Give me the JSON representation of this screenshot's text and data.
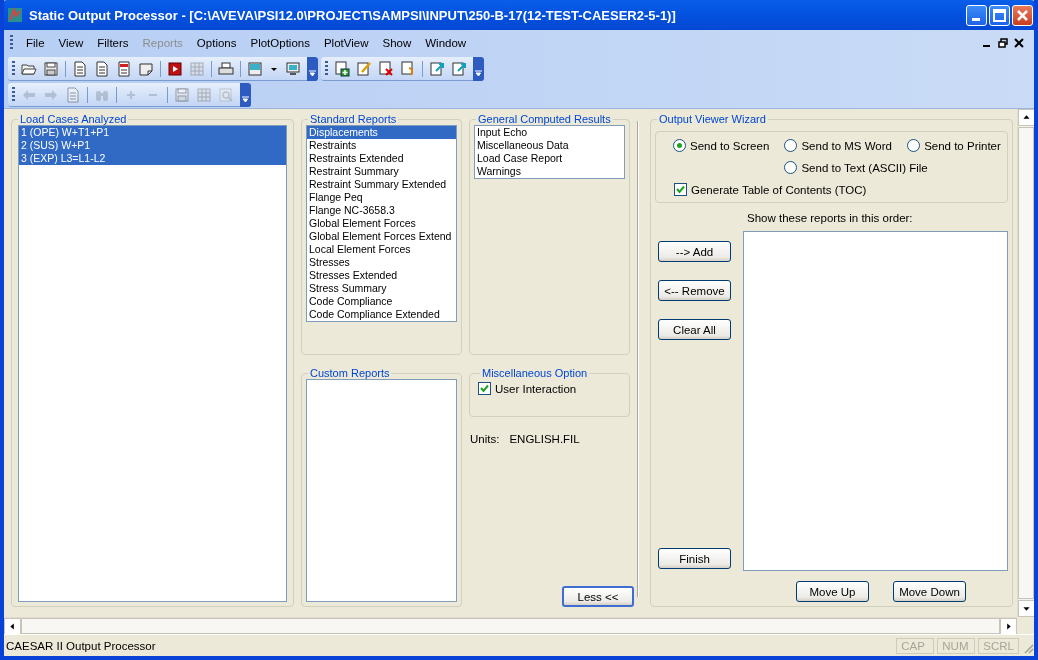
{
  "window": {
    "title": "Static Output Processor - [C:\\AVEVA\\PSI12.0\\PROJECT\\SAMPSI\\INPUT\\250-B-17(12-TEST-CAESER2-5-1)]"
  },
  "menu": [
    {
      "label": "File",
      "disabled": false
    },
    {
      "label": "View",
      "disabled": false
    },
    {
      "label": "Filters",
      "disabled": false
    },
    {
      "label": "Reports",
      "disabled": true
    },
    {
      "label": "Options",
      "disabled": false
    },
    {
      "label": "PlotOptions",
      "disabled": false
    },
    {
      "label": "PlotView",
      "disabled": false
    },
    {
      "label": "Show",
      "disabled": false
    },
    {
      "label": "Window",
      "disabled": false
    }
  ],
  "toolbars": [
    [
      [
        {
          "kind": "open",
          "disabled": false
        },
        {
          "kind": "save",
          "disabled": false
        }
      ],
      [
        {
          "kind": "page",
          "disabled": false
        },
        {
          "kind": "page",
          "disabled": false
        },
        {
          "kind": "redpage",
          "disabled": false
        },
        {
          "kind": "fold",
          "disabled": false
        }
      ],
      [
        {
          "kind": "play",
          "disabled": false
        },
        {
          "kind": "grid",
          "disabled": true
        }
      ],
      [
        {
          "kind": "print",
          "disabled": false
        }
      ],
      [
        {
          "kind": "word",
          "disabled": false
        },
        {
          "kind": "caret",
          "disabled": false
        },
        {
          "kind": "monitor",
          "disabled": false
        }
      ]
    ],
    [
      [
        {
          "kind": "adddoc",
          "disabled": false
        },
        {
          "kind": "editdoc",
          "disabled": false
        },
        {
          "kind": "deldoc",
          "disabled": false
        },
        {
          "kind": "arrowdoc",
          "disabled": false
        }
      ],
      [
        {
          "kind": "exportdoc",
          "disabled": false
        },
        {
          "kind": "exportdoc",
          "disabled": false
        }
      ]
    ],
    [
      [
        {
          "kind": "left",
          "disabled": true
        },
        {
          "kind": "right",
          "disabled": true
        },
        {
          "kind": "page",
          "disabled": true
        }
      ],
      [
        {
          "kind": "binoculars",
          "disabled": true
        }
      ],
      [
        {
          "kind": "plus",
          "disabled": true
        },
        {
          "kind": "minus",
          "disabled": true
        }
      ],
      [
        {
          "kind": "save",
          "disabled": true
        },
        {
          "kind": "grid",
          "disabled": true
        },
        {
          "kind": "zoom",
          "disabled": true
        }
      ]
    ]
  ],
  "load_cases": {
    "title": "Load Cases Analyzed",
    "items": [
      {
        "label": "1 (OPE) W+T1+P1",
        "selected": true
      },
      {
        "label": "2 (SUS) W+P1",
        "selected": true
      },
      {
        "label": "3 (EXP) L3=L1-L2",
        "selected": true
      }
    ]
  },
  "standard_reports": {
    "title": "Standard Reports",
    "items": [
      {
        "label": "Displacements",
        "selected": true
      },
      {
        "label": "Restraints",
        "selected": false
      },
      {
        "label": "Restraints Extended",
        "selected": false
      },
      {
        "label": "Restraint Summary",
        "selected": false
      },
      {
        "label": "Restraint Summary Extended",
        "selected": false
      },
      {
        "label": "Flange Peq",
        "selected": false
      },
      {
        "label": "Flange NC-3658.3",
        "selected": false
      },
      {
        "label": "Global Element Forces",
        "selected": false
      },
      {
        "label": "Global Element Forces Extend",
        "selected": false
      },
      {
        "label": "Local Element Forces",
        "selected": false
      },
      {
        "label": "Stresses",
        "selected": false
      },
      {
        "label": "Stresses Extended",
        "selected": false
      },
      {
        "label": "Stress Summary",
        "selected": false
      },
      {
        "label": "Code Compliance",
        "selected": false
      },
      {
        "label": "Code Compliance Extended",
        "selected": false
      }
    ]
  },
  "general_results": {
    "title": "General Computed Results",
    "items": [
      {
        "label": "Input Echo",
        "selected": false
      },
      {
        "label": "Miscellaneous Data",
        "selected": false
      },
      {
        "label": "Load Case Report",
        "selected": false
      },
      {
        "label": "Warnings",
        "selected": false
      }
    ]
  },
  "custom_reports": {
    "title": "Custom Reports"
  },
  "misc_option": {
    "title": "Miscellaneous Option",
    "checkbox": {
      "label": "User Interaction",
      "checked": true
    }
  },
  "units": {
    "label": "Units:",
    "value": "ENGLISH.FIL"
  },
  "less_button": "Less <<",
  "wizard": {
    "title": "Output Viewer Wizard",
    "destinations": [
      {
        "label": "Send to Screen",
        "selected": true
      },
      {
        "label": "Send to MS Word",
        "selected": false
      },
      {
        "label": "Send to Printer",
        "selected": false
      },
      {
        "label": "Send to Text (ASCII) File",
        "selected": false
      }
    ],
    "toc": {
      "label": "Generate Table of Contents (TOC)",
      "checked": true
    },
    "buttons": [
      "--> Add",
      "<-- Remove",
      "Clear All"
    ],
    "finish": "Finish",
    "order_label": "Show these reports in this order:",
    "order_buttons": [
      "Move Up",
      "Move Down"
    ]
  },
  "status_bar": {
    "text": "CAESAR II Output Processor",
    "indicators": [
      {
        "label": "CAP",
        "on": false
      },
      {
        "label": "NUM",
        "on": false
      },
      {
        "label": "SCRL",
        "on": false
      }
    ]
  }
}
